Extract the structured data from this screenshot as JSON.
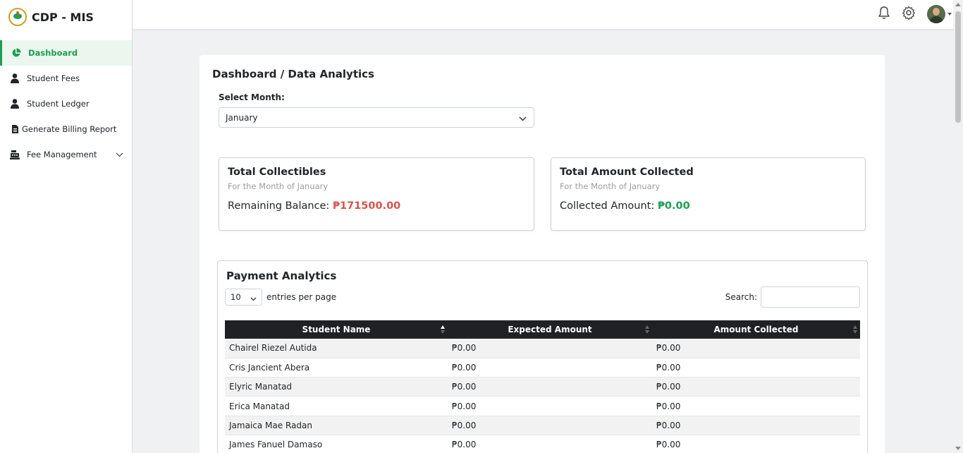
{
  "app": {
    "name": "CDP - MIS"
  },
  "sidebar": {
    "items": [
      {
        "label": "Dashboard",
        "icon": "pie-chart-icon",
        "active": true
      },
      {
        "label": "Student Fees",
        "icon": "user-icon"
      },
      {
        "label": "Student Ledger",
        "icon": "user-icon"
      },
      {
        "label": "Generate Billing Report",
        "icon": "file-icon"
      },
      {
        "label": "Fee Management",
        "icon": "cash-register-icon"
      }
    ]
  },
  "topbar": {
    "icons": [
      "bell-icon",
      "gear-icon",
      "avatar"
    ]
  },
  "page": {
    "title": "Dashboard / Data Analytics",
    "month_label": "Select Month:",
    "month_value": "January"
  },
  "stats": {
    "collectibles": {
      "title": "Total Collectibles",
      "subtitle": "For the Month of January",
      "line_label": "Remaining Balance: ",
      "amount": "₱171500.00"
    },
    "collected": {
      "title": "Total Amount Collected",
      "subtitle": "For the Month of January",
      "line_label": "Collected Amount: ",
      "amount": "₱0.00"
    }
  },
  "analytics": {
    "title": "Payment Analytics",
    "entries_value": "10",
    "entries_label": "entries per page",
    "search_label": "Search:",
    "columns": [
      "Student Name",
      "Expected Amount",
      "Amount Collected"
    ],
    "rows": [
      [
        "Chairel Riezel Autida",
        "₱0.00",
        "₱0.00"
      ],
      [
        "Cris Jancient Abera",
        "₱0.00",
        "₱0.00"
      ],
      [
        "Elyric Manatad",
        "₱0.00",
        "₱0.00"
      ],
      [
        "Erica Manatad",
        "₱0.00",
        "₱0.00"
      ],
      [
        "Jamaica Mae Radan",
        "₱0.00",
        "₱0.00"
      ],
      [
        "James Fanuel Damaso",
        "₱0.00",
        "₱0.00"
      ]
    ]
  },
  "colors": {
    "accent": "#1f9d55",
    "danger": "#d9534f",
    "table_header": "#1f2124"
  }
}
